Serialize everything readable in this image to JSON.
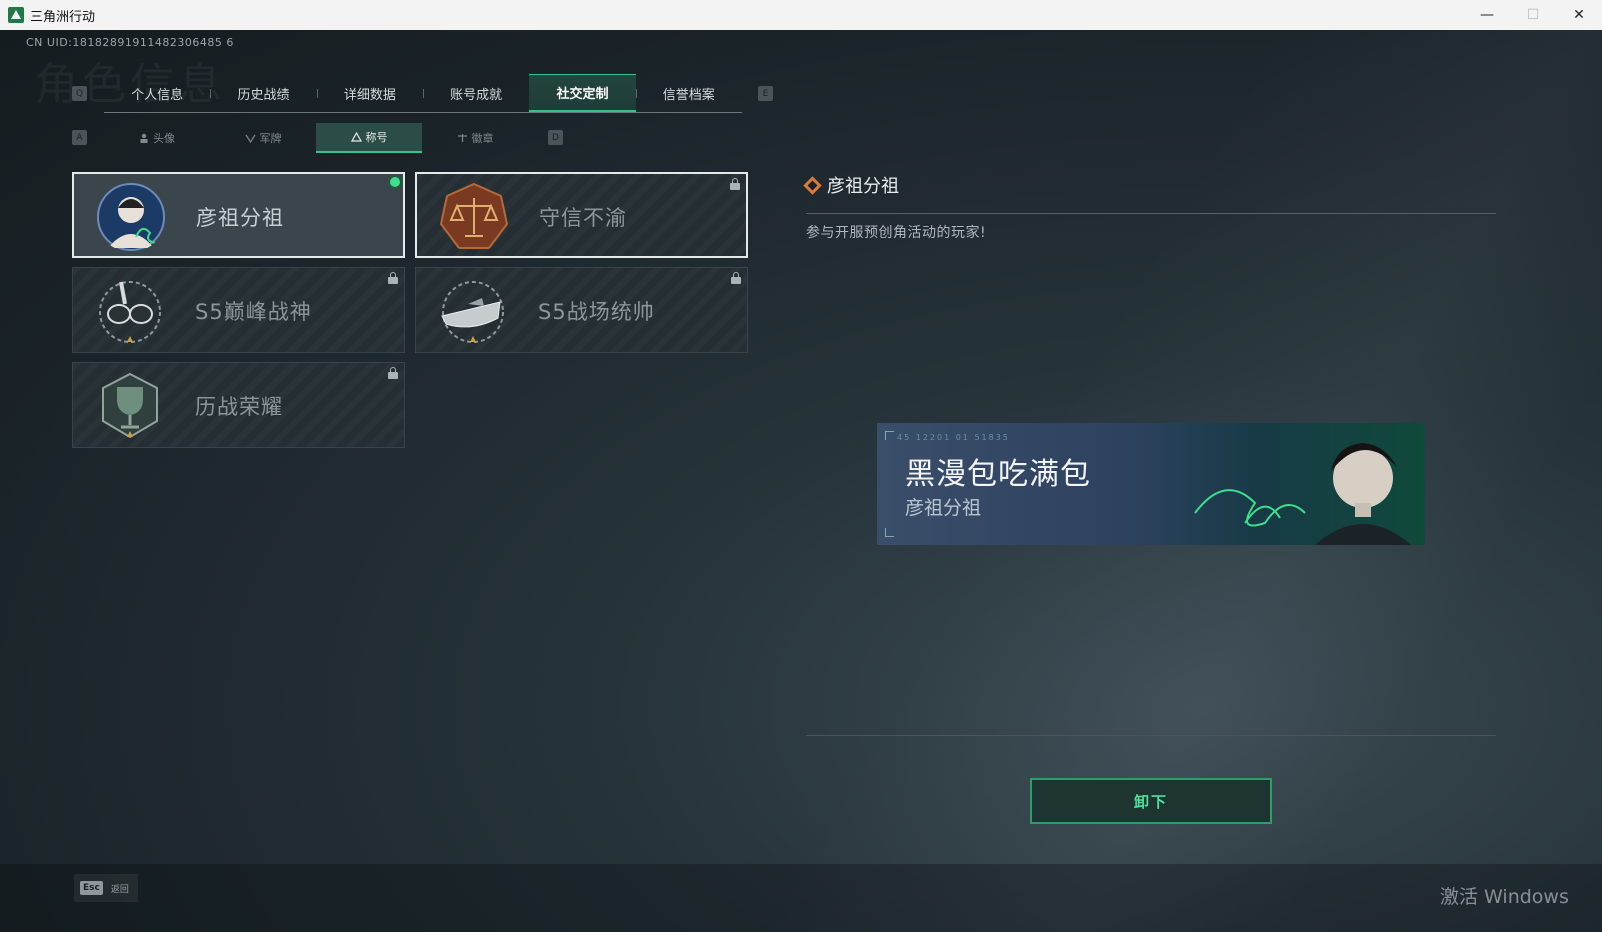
{
  "window": {
    "title": "三角洲行动",
    "controls": [
      "—",
      "☐",
      "✕"
    ]
  },
  "uid": "CN UID:18182891911482306485 6",
  "background_heading": "角色信息",
  "keys": {
    "prev_tab": "Q",
    "next_tab": "E",
    "prev_sub": "A",
    "next_sub": "D"
  },
  "tabs": [
    {
      "label": "个人信息"
    },
    {
      "label": "历史战绩"
    },
    {
      "label": "详细数据"
    },
    {
      "label": "账号成就"
    },
    {
      "label": "社交定制",
      "active": true
    },
    {
      "label": "信誉档案"
    }
  ],
  "subtabs": [
    {
      "label": "头像",
      "icon": "person-icon"
    },
    {
      "label": "军牌",
      "icon": "dogtag-icon"
    },
    {
      "label": "称号",
      "icon": "triangle-icon",
      "active": true
    },
    {
      "label": "徽章",
      "icon": "badge-icon"
    }
  ],
  "titles": [
    {
      "name": "彦祖分祖",
      "equipped": true,
      "selected": true,
      "locked": false,
      "emblem": "portrait-emblem-icon"
    },
    {
      "name": "守信不渝",
      "equipped": false,
      "selected": true,
      "locked": true,
      "emblem": "scales-emblem-icon"
    },
    {
      "name": "S5巅峰战神",
      "equipped": false,
      "selected": false,
      "locked": true,
      "emblem": "diving-mask-emblem-icon"
    },
    {
      "name": "S5战场统帅",
      "equipped": false,
      "selected": false,
      "locked": true,
      "emblem": "boat-emblem-icon"
    },
    {
      "name": "历战荣耀",
      "equipped": false,
      "selected": false,
      "locked": true,
      "emblem": "trophy-emblem-icon"
    }
  ],
  "detail": {
    "title": "彦祖分祖",
    "description": "参与开服预创角活动的玩家!",
    "banner": {
      "code": "45 12201  01 51835",
      "player_name": "黑漫包吃满包",
      "title": "彦祖分祖"
    },
    "action": "卸下"
  },
  "footer": {
    "esc_key": "Esc",
    "esc_label": "返回"
  },
  "os_watermark": "激活 Windows",
  "colors": {
    "accent": "#36c28a",
    "equip_dot": "#3dde8c",
    "diamond": "#d97a3a"
  }
}
